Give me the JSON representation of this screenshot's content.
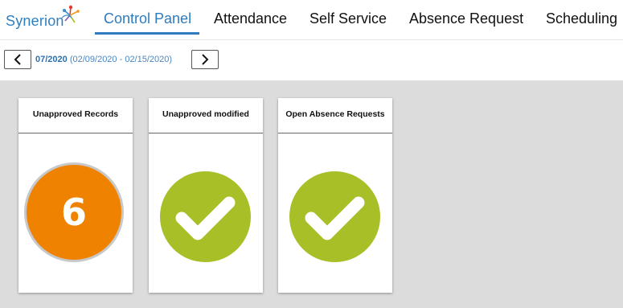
{
  "brand": {
    "name": "Synerion",
    "text_color": "#2f7fbf"
  },
  "nav": {
    "items": [
      {
        "label": "Control Panel",
        "active": true
      },
      {
        "label": "Attendance",
        "active": false
      },
      {
        "label": "Self Service",
        "active": false
      },
      {
        "label": "Absence Request",
        "active": false
      },
      {
        "label": "Scheduling",
        "active": false
      }
    ],
    "active_color": "#2e7bbf"
  },
  "period": {
    "prev_icon": "chevron-left-icon",
    "label": "07/2020",
    "range": "(02/09/2020 - 02/15/2020)",
    "next_icon": "chevron-right-icon"
  },
  "cards": [
    {
      "title": "Unapproved Records",
      "kind": "count",
      "value": "6",
      "color": "#ef8200"
    },
    {
      "title": "Unapproved modified",
      "kind": "check",
      "icon": "checkmark-icon",
      "color": "#a8bf27"
    },
    {
      "title": "Open Absence Requests",
      "kind": "check",
      "icon": "checkmark-icon",
      "color": "#a8bf27"
    }
  ]
}
